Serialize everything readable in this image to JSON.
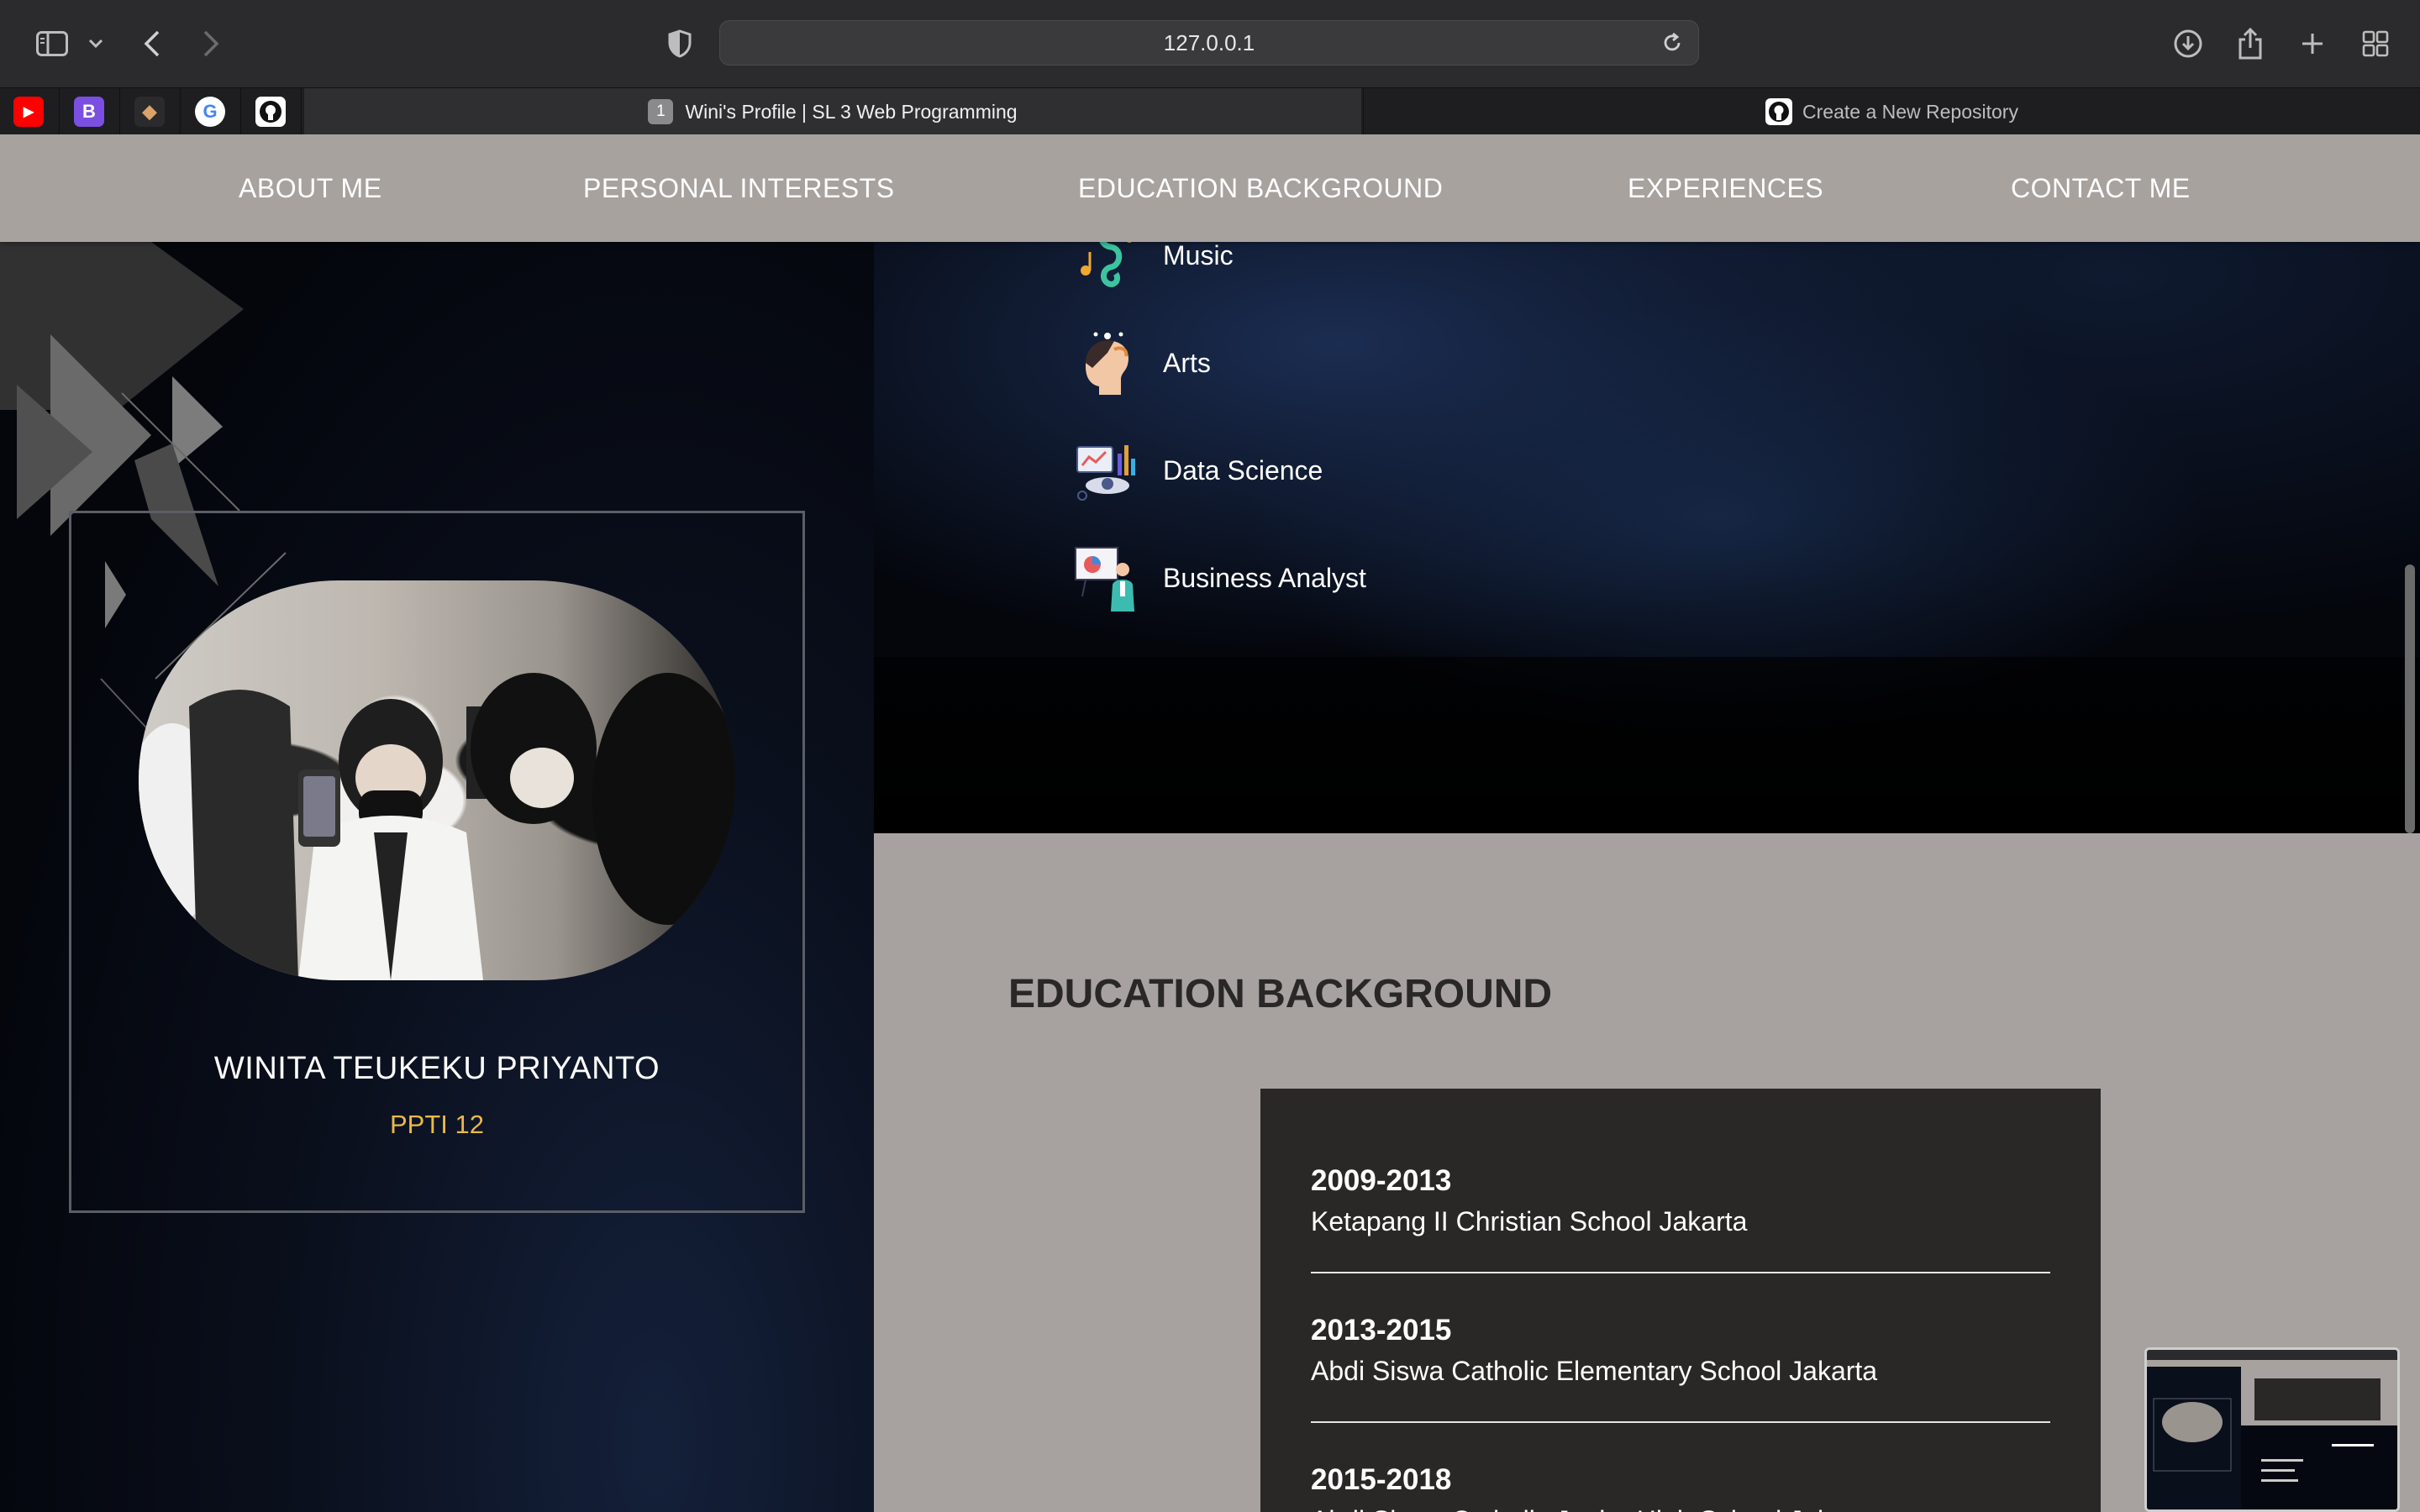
{
  "browser": {
    "url": "127.0.0.1",
    "tabs": [
      {
        "label": "Wini's Profile | SL 3 Web Programming",
        "badge": "1",
        "active": true
      },
      {
        "label": "Create a New Repository",
        "active": false
      }
    ],
    "favorites": [
      {
        "name": "youtube-favicon",
        "glyph": "▶",
        "color": "#ff0000"
      },
      {
        "name": "bootstrap-favicon",
        "glyph": "B",
        "color": "#7b4fe0"
      },
      {
        "name": "extension-favicon",
        "glyph": "🐻",
        "color": "#2b2b2d"
      },
      {
        "name": "google-favicon",
        "glyph": "G",
        "color": "#ffffff"
      },
      {
        "name": "github-favicon",
        "glyph": "",
        "color": "#ffffff"
      }
    ]
  },
  "nav": {
    "items": [
      "ABOUT ME",
      "PERSONAL INTERESTS",
      "EDUCATION BACKGROUND",
      "EXPERIENCES",
      "CONTACT ME"
    ]
  },
  "profile": {
    "name": "WINITA TEUKEKU PRIYANTO",
    "subtitle": "PPTI 12"
  },
  "interests": [
    {
      "label": "Music",
      "icon": "music-icon"
    },
    {
      "label": "Arts",
      "icon": "arts-icon"
    },
    {
      "label": "Data Science",
      "icon": "data-science-icon"
    },
    {
      "label": "Business Analyst",
      "icon": "business-analyst-icon"
    }
  ],
  "education": {
    "title": "EDUCATION BACKGROUND",
    "entries": [
      {
        "years": "2009-2013",
        "school": "Ketapang II Christian School Jakarta"
      },
      {
        "years": "2013-2015",
        "school": "Abdi Siswa Catholic Elementary School Jakarta"
      },
      {
        "years": "2015-2018",
        "school": "Abdi Siswa Catholic Junior High School Jakarta"
      }
    ]
  },
  "colors": {
    "nav_bg": "#a8a29f",
    "accent_gold": "#e9b94a",
    "edu_box": "#2a2727",
    "light_section": "#a7a29f"
  }
}
